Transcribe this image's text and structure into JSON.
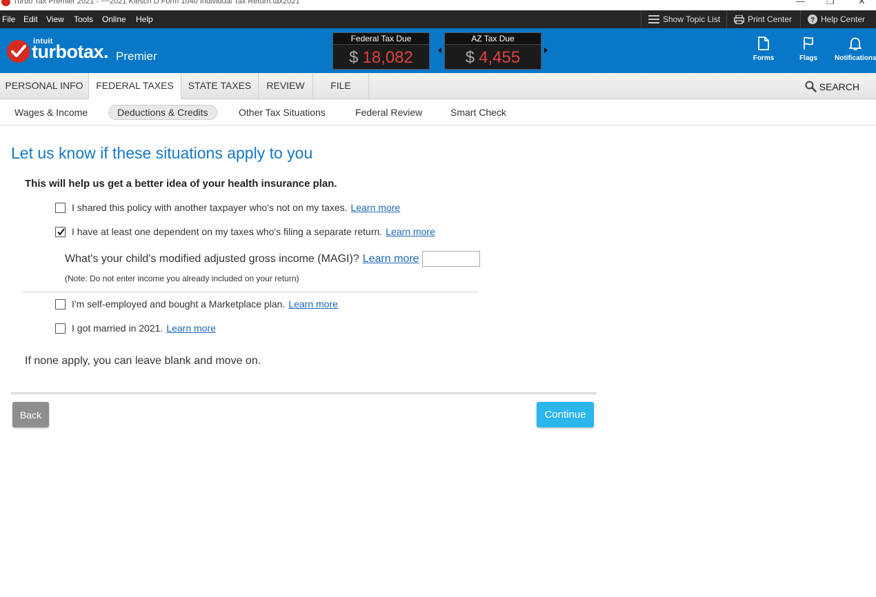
{
  "window": {
    "title": "Turbo Tax Premier 2021 - ~~2021 Klesch D Form 1040  Individual Tax Return.tax2021",
    "minimize_glyph": "—",
    "restore_glyph": "❐",
    "close_glyph": "✕"
  },
  "menubar": {
    "items": [
      "File",
      "Edit",
      "View",
      "Tools",
      "Online",
      "Help"
    ],
    "show_topic_list": "Show Topic List",
    "print_center": "Print Center",
    "help_center": "Help Center"
  },
  "header": {
    "brand_intuit": "intuit",
    "brand_name": "turbotax",
    "brand_dot": ".",
    "edition": "Premier",
    "federal": {
      "label": "Federal Tax Due",
      "currency": "$",
      "amount": "18,082"
    },
    "state": {
      "label": "AZ Tax Due",
      "currency": "$",
      "amount": "4,455"
    },
    "buttons": {
      "forms": "Forms",
      "flags": "Flags",
      "notifications": "Notifications"
    },
    "colors": {
      "header_bg": "#0877c7",
      "amount_red": "#e34040",
      "brand_red": "#d52b1e"
    }
  },
  "tabs": {
    "items": [
      "PERSONAL INFO",
      "FEDERAL TAXES",
      "STATE TAXES",
      "REVIEW",
      "FILE"
    ],
    "active": "FEDERAL TAXES",
    "search": "SEARCH"
  },
  "subtabs": {
    "items": [
      "Wages & Income",
      "Deductions & Credits",
      "Other Tax Situations",
      "Federal Review",
      "Smart Check"
    ],
    "active": "Deductions & Credits"
  },
  "content": {
    "title": "Let us know if these situations apply to you",
    "subheading": "This will help us get a better idea of your health insurance plan.",
    "options": [
      {
        "label": "I shared this policy with another taxpayer who's not on my taxes.",
        "link": "Learn more",
        "checked": false
      },
      {
        "label": "I have at least one dependent on my taxes who's filing a separate return.",
        "link": "Learn more",
        "checked": true
      },
      {
        "label": "I'm self-employed and bought a Marketplace plan.",
        "link": "Learn more",
        "checked": false
      },
      {
        "label": "I got married in 2021.",
        "link": "Learn more",
        "checked": false
      }
    ],
    "magi_question": "What's your child's modified adjusted gross income (MAGI)?",
    "magi_link": "Learn more",
    "magi_value": "",
    "note": "(Note: Do not enter income you already included on your return)",
    "none_apply": "If none apply, you can leave blank and move on."
  },
  "footer": {
    "back": "Back",
    "continue": "Continue",
    "colors": {
      "back_bg": "#8e8e8e",
      "continue_bg": "#2bb6ee"
    }
  }
}
